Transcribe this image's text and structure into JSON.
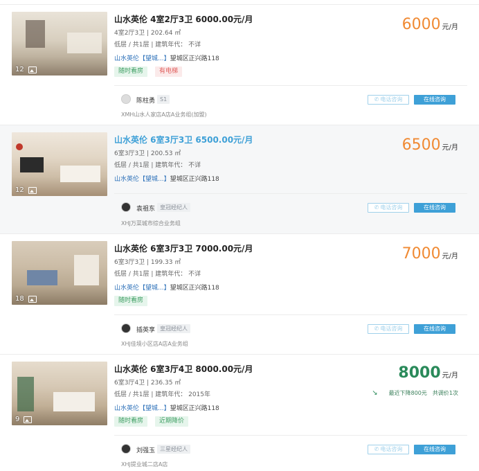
{
  "listings": [
    {
      "title": "山水英伦 4室2厅3卫 6000.00元/月",
      "layout": "4室2厅3卫 | 202.64 ㎡",
      "floor": "低层 / 共1层 | 建筑年代： 不详",
      "community": "山水英伦【望城...】",
      "address": "望城区正兴路118",
      "tags": [
        "随时看房",
        "有电梯"
      ],
      "photo_count": "12",
      "price": "6000",
      "price_unit": "元/月",
      "agent": {
        "name": "陈柱勇",
        "level": "S1",
        "store": "XMH山水人家店A店A业务组(加盟)"
      },
      "phone_btn": "电话咨询",
      "online_btn": "在线咨询"
    },
    {
      "title": "山水英伦 6室3厅3卫 6500.00元/月",
      "layout": "6室3厅3卫 | 200.53 ㎡",
      "floor": "低层 / 共1层 | 建筑年代： 不详",
      "community": "山水英伦【望城...】",
      "address": "望城区正兴路118",
      "tags": [],
      "photo_count": "12",
      "price": "6500",
      "price_unit": "元/月",
      "agent": {
        "name": "袁祖东",
        "level": "皇冠经纪人",
        "store": "XHJ万菜城市综合业务组"
      },
      "phone_btn": "电话咨询",
      "online_btn": "在线咨询"
    },
    {
      "title": "山水英伦 6室3厅3卫 7000.00元/月",
      "layout": "6室3厅3卫 | 199.33 ㎡",
      "floor": "低层 / 共1层 | 建筑年代： 不详",
      "community": "山水英伦【望城...】",
      "address": "望城区正兴路118",
      "tags": [
        "随时看房"
      ],
      "photo_count": "18",
      "price": "7000",
      "price_unit": "元/月",
      "agent": {
        "name": "插英享",
        "level": "皇冠经纪人",
        "store": "XHJ佳境小区店A店A业务组"
      },
      "phone_btn": "电话咨询",
      "online_btn": "在线咨询"
    },
    {
      "title": "山水英伦 6室3厅4卫 8000.00元/月",
      "layout": "6室3厅4卫 | 236.35 ㎡",
      "floor": "低层 / 共1层 | 建筑年代： 2015年",
      "community": "山水英伦【望城...】",
      "address": "望城区正兴路118",
      "tags": [
        "随时看房",
        "近期降价"
      ],
      "photo_count": "9",
      "price": "8000",
      "price_unit": "元/月",
      "price_drop": "最近下降800元",
      "price_adjust_count": "共调价1次",
      "agent": {
        "name": "刘强玉",
        "level": "三星经纪人",
        "store": "XHJ提业城二店A店"
      },
      "phone_btn": "电话咨询",
      "online_btn": "在线咨询"
    }
  ],
  "colors": {
    "accent_blue": "#3ea0d7",
    "price_orange": "#f08a33",
    "price_green": "#2a8a5a",
    "tag_green": "#3f9f63",
    "tag_red": "#e0605e"
  }
}
